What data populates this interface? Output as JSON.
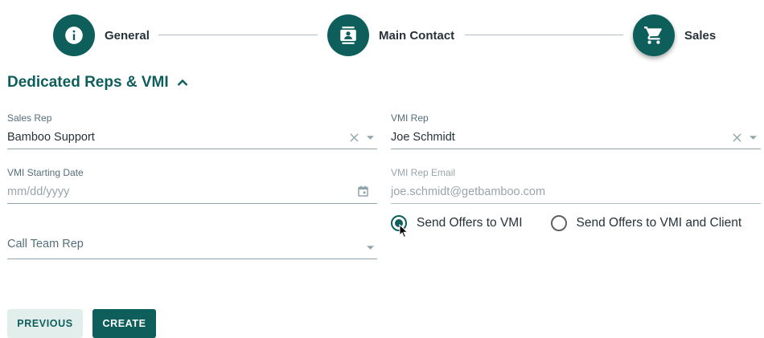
{
  "stepper": {
    "steps": [
      {
        "label": "General",
        "icon": "info-icon"
      },
      {
        "label": "Main Contact",
        "icon": "contact-card-icon"
      },
      {
        "label": "Sales",
        "icon": "cart-icon"
      }
    ]
  },
  "section": {
    "title": "Dedicated Reps & VMI"
  },
  "form": {
    "sales_rep": {
      "label": "Sales Rep",
      "value": "Bamboo Support"
    },
    "vmi_rep": {
      "label": "VMI Rep",
      "value": "Joe Schmidt"
    },
    "vmi_start_date": {
      "label": "VMI Starting Date",
      "placeholder": "mm/dd/yyyy"
    },
    "vmi_rep_email": {
      "label": "VMI Rep Email",
      "value": "joe.schmidt@getbamboo.com"
    },
    "call_team_rep": {
      "placeholder": "Call Team Rep"
    },
    "send_offers": {
      "options": [
        {
          "label": "Send Offers to VMI",
          "selected": true
        },
        {
          "label": "Send Offers to VMI and Client",
          "selected": false
        }
      ]
    }
  },
  "actions": {
    "previous_label": "PREVIOUS",
    "create_label": "CREATE"
  },
  "colors": {
    "primary": "#0e5f5c",
    "divider": "#b0bec5"
  }
}
